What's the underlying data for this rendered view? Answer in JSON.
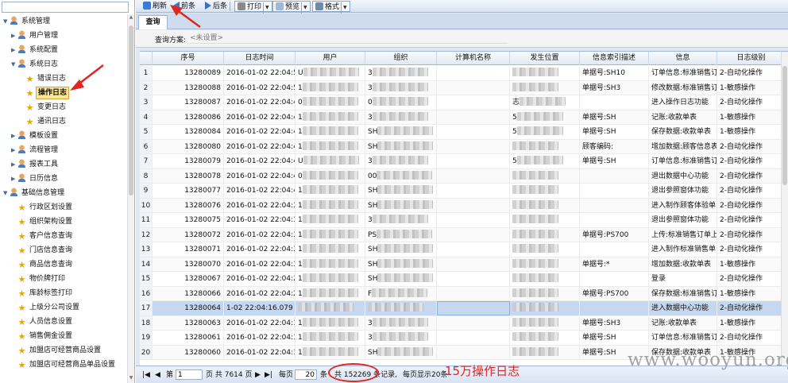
{
  "sidebar": {
    "items": [
      {
        "label": "系统管理",
        "level": 0,
        "arrow": "▼",
        "icon": "person-icon"
      },
      {
        "label": "用户管理",
        "level": 1,
        "arrow": "▶",
        "icon": "person-icon"
      },
      {
        "label": "系统配置",
        "level": 1,
        "arrow": "▶",
        "icon": "person-icon"
      },
      {
        "label": "系统日志",
        "level": 1,
        "arrow": "▼",
        "icon": "person-icon"
      },
      {
        "label": "错误日志",
        "level": 2,
        "arrow": "",
        "icon": "star-icon"
      },
      {
        "label": "操作日志",
        "level": 2,
        "arrow": "",
        "icon": "star-icon",
        "selected": true
      },
      {
        "label": "变更日志",
        "level": 2,
        "arrow": "",
        "icon": "star-icon"
      },
      {
        "label": "通讯日志",
        "level": 2,
        "arrow": "",
        "icon": "star-icon"
      },
      {
        "label": "模板设置",
        "level": 1,
        "arrow": "▶",
        "icon": "person-icon"
      },
      {
        "label": "流程管理",
        "level": 1,
        "arrow": "▶",
        "icon": "person-icon"
      },
      {
        "label": "报表工具",
        "level": 1,
        "arrow": "▶",
        "icon": "person-icon"
      },
      {
        "label": "日历信息",
        "level": 1,
        "arrow": "▶",
        "icon": "person-icon"
      },
      {
        "label": "基础信息管理",
        "level": 0,
        "arrow": "▼",
        "icon": "person-icon"
      },
      {
        "label": "行政区划设置",
        "level": 1,
        "arrow": "",
        "icon": "star-icon"
      },
      {
        "label": "组织架构设置",
        "level": 1,
        "arrow": "",
        "icon": "star-icon"
      },
      {
        "label": "客户信息查询",
        "level": 1,
        "arrow": "",
        "icon": "star-icon"
      },
      {
        "label": "门店信息查询",
        "level": 1,
        "arrow": "",
        "icon": "star-icon"
      },
      {
        "label": "商品信息查询",
        "level": 1,
        "arrow": "",
        "icon": "star-icon"
      },
      {
        "label": "物价牌打印",
        "level": 1,
        "arrow": "",
        "icon": "star-icon"
      },
      {
        "label": "库龄标签打印",
        "level": 1,
        "arrow": "",
        "icon": "star-icon"
      },
      {
        "label": "上级分公司设置",
        "level": 1,
        "arrow": "",
        "icon": "star-icon"
      },
      {
        "label": "人员信息设置",
        "level": 1,
        "arrow": "",
        "icon": "star-icon"
      },
      {
        "label": "销售佣金设置",
        "level": 1,
        "arrow": "",
        "icon": "star-icon"
      },
      {
        "label": "加盟店可经营商品设置",
        "level": 1,
        "arrow": "",
        "icon": "star-icon"
      },
      {
        "label": "加盟店可经营商品单品设置",
        "level": 1,
        "arrow": "",
        "icon": "star-icon"
      }
    ]
  },
  "toolbar": {
    "refresh": "刷新",
    "prev": "前条",
    "next": "后条",
    "print": "打印",
    "preview": "预览",
    "format": "格式"
  },
  "tab": {
    "label": "查询"
  },
  "query": {
    "label": "查询方案:",
    "placeholder": "<未设置>"
  },
  "grid": {
    "columns": [
      "序号",
      "日志时间",
      "用户",
      "组织",
      "计算机名称",
      "发生位置",
      "信息索引描述",
      "信息",
      "日志级别"
    ],
    "rows": [
      {
        "n": "1",
        "seq": "13280089",
        "time": "2016-01-02 22:04:5",
        "user": "U",
        "org": "3",
        "pos": "",
        "idx": "单据号:SH10",
        "info": "订单信息:标准销售订",
        "level": "2-自动化操作"
      },
      {
        "n": "2",
        "seq": "13280088",
        "time": "2016-01-02 22:04:5",
        "user": "1",
        "org": "3",
        "pos": "",
        "idx": "单据号:SH3",
        "info": "修改数据:标准销售订",
        "level": "1-敏感操作"
      },
      {
        "n": "3",
        "seq": "13280087",
        "time": "2016-01-02 22:04:4",
        "user": "0",
        "org": "0",
        "pos": "志",
        "idx": "",
        "info": "进入操作日志功能",
        "level": "2-自动化操作"
      },
      {
        "n": "4",
        "seq": "13280086",
        "time": "2016-01-02 22:04:4",
        "user": "1",
        "org": "3",
        "pos": "5",
        "idx": "单据号:SH",
        "info": "记账:收款单表",
        "level": "1-敏感操作"
      },
      {
        "n": "5",
        "seq": "13280084",
        "time": "2016-01-02 22:04:4",
        "user": "1",
        "org": "SH",
        "pos": "5",
        "idx": "单据号:SH",
        "info": "保存数据:收款单表",
        "level": "1-敏感操作"
      },
      {
        "n": "6",
        "seq": "13280080",
        "time": "2016-01-02 22:04:4",
        "user": "1",
        "org": "SH",
        "pos": "",
        "idx": "顾客编码:",
        "info": "增加数据:顾客信息表",
        "level": "2-自动化操作"
      },
      {
        "n": "7",
        "seq": "13280079",
        "time": "2016-01-02 22:04:4",
        "user": "U",
        "org": "3",
        "pos": "5",
        "idx": "单据号:SH",
        "info": "订单信息:标准销售订",
        "level": "2-自动化操作"
      },
      {
        "n": "8",
        "seq": "13280078",
        "time": "2016-01-02 22:04:4",
        "user": "0",
        "org": "00",
        "pos": "",
        "idx": "",
        "info": "退出数据中心功能",
        "level": "2-自动化操作"
      },
      {
        "n": "9",
        "seq": "13280077",
        "time": "2016-01-02 22:04:4",
        "user": "1",
        "org": "SH",
        "pos": "",
        "idx": "",
        "info": "退出参照窗体功能",
        "level": "2-自动化操作"
      },
      {
        "n": "10",
        "seq": "13280076",
        "time": "2016-01-02 22:04:3",
        "user": "1",
        "org": "SH",
        "pos": "",
        "idx": "",
        "info": "进入制作顾客体验单",
        "level": "2-自动化操作"
      },
      {
        "n": "11",
        "seq": "13280075",
        "time": "2016-01-02 22:04:3",
        "user": "1",
        "org": "3",
        "pos": "",
        "idx": "",
        "info": "退出参照窗体功能",
        "level": "2-自动化操作"
      },
      {
        "n": "12",
        "seq": "13280072",
        "time": "2016-01-02 22:04:3",
        "user": "1",
        "org": "PS",
        "pos": "",
        "idx": "单据号:PS700",
        "info": "上传:标准销售订单上",
        "level": "2-自动化操作"
      },
      {
        "n": "13",
        "seq": "13280071",
        "time": "2016-01-02 22:04:3",
        "user": "1",
        "org": "SH",
        "pos": "",
        "idx": "",
        "info": "进入制作标准销售单",
        "level": "2-自动化操作"
      },
      {
        "n": "14",
        "seq": "13280070",
        "time": "2016-01-02 22:04:3",
        "user": "1",
        "org": "SH",
        "pos": "",
        "idx": "单据号:*",
        "info": "增加数据:收款单表",
        "level": "1-敏感操作"
      },
      {
        "n": "15",
        "seq": "13280067",
        "time": "2016-01-02 22:04:2",
        "user": "1",
        "org": "SH",
        "pos": "",
        "idx": "",
        "info": "登录",
        "level": "2-自动化操作"
      },
      {
        "n": "16",
        "seq": "13280066",
        "time": "2016-01-02 22:04:2",
        "user": "1",
        "org": "F",
        "pos": "",
        "idx": "单据号:PS700",
        "info": "保存数据:标准销售订",
        "level": "1-敏感操作"
      },
      {
        "n": "17",
        "seq": "13280064",
        "time": "1-02 22:04:16.079",
        "user": "",
        "org": "",
        "pos": "",
        "idx": "",
        "info": "进入数据中心功能",
        "level": "2-自动化操作",
        "selected": true
      },
      {
        "n": "18",
        "seq": "13280063",
        "time": "2016-01-02 22:04:1",
        "user": "1",
        "org": "3",
        "pos": "",
        "idx": "单据号:SH3",
        "info": "记账:收款单表",
        "level": "1-敏感操作"
      },
      {
        "n": "19",
        "seq": "13280061",
        "time": "2016-01-02 22:04:1",
        "user": "1",
        "org": "3",
        "pos": "",
        "idx": "单据号:SH",
        "info": "订单信息:标准销售订",
        "level": "2-自动化操作"
      },
      {
        "n": "20",
        "seq": "13280060",
        "time": "2016-01-02 22:04:1",
        "user": "1",
        "org": "SH",
        "pos": "",
        "idx": "单据号:SH",
        "info": "保存数据:收款单表",
        "level": "1-敏感操作"
      }
    ]
  },
  "pager": {
    "page_prefix": "第",
    "page_value": "1",
    "page_total": "页 共 7614 页",
    "per_page_prefix": "每页",
    "per_page_value": "20",
    "per_page_suffix": "条",
    "total_text": "共 152269 条记录,",
    "display_text": "每页显示20条"
  },
  "annotation": {
    "text": "15万操作日志",
    "color": "#e0261f"
  },
  "watermark": "www.wooyun.org",
  "colors": {
    "selected_row": "#c5d8ef",
    "toolbar_bg": "#d7e3f3",
    "tree_selected": "#fbe596"
  }
}
